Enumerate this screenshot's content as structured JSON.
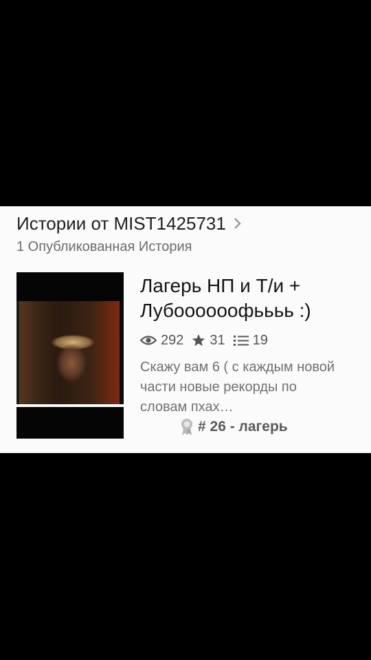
{
  "header": {
    "title": "Истории от MIST1425731",
    "subtitle": "1 Опубликованная История"
  },
  "story": {
    "title": "Лагерь НП и Т/и + Лубоооооофьььь :)",
    "views": "292",
    "votes": "31",
    "parts": "19",
    "description": "Скажу вам 6 ( с каждым новой части новые рекорды по словам пхах…",
    "rank": "# 26 - лагерь"
  },
  "icons": {
    "chevron": "chevron-right-icon",
    "views": "eye-icon",
    "votes": "star-icon",
    "parts": "list-icon",
    "rank": "ribbon-medal-icon"
  },
  "colors": {
    "background": "#000000",
    "panel": "#fbfbfb",
    "title_text": "#1f1f1f",
    "muted_text": "#6b6b6b"
  }
}
